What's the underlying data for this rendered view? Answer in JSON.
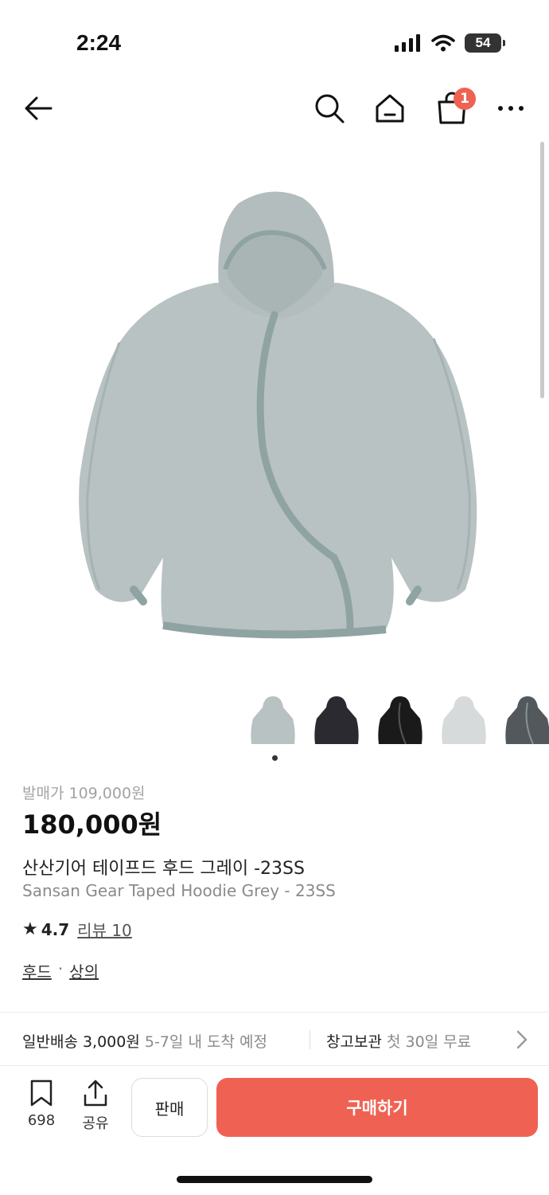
{
  "status_bar": {
    "time": "2:24",
    "battery": "54",
    "icons": [
      "signal-icon",
      "wifi-icon",
      "battery-icon"
    ]
  },
  "nav": {
    "icons": [
      "back-arrow-icon",
      "search-icon",
      "home-icon",
      "shopping-bag-icon",
      "more-icon"
    ],
    "cart_badge": "1"
  },
  "product": {
    "image_alt": "gray hoodie",
    "thumbnails": [
      {
        "name": "grey",
        "color": "#b8c2c2"
      },
      {
        "name": "black-navy",
        "color": "#2a2a30"
      },
      {
        "name": "black-taped",
        "color": "#1a1a1a"
      },
      {
        "name": "light-grey",
        "color": "#d6dadb"
      },
      {
        "name": "charcoal",
        "color": "#52585c"
      }
    ],
    "release_price": "발매가 109,000원",
    "price": "180,000원",
    "name_ko": "산산기어 테이프드 후드 그레이 -23SS",
    "name_en": "Sansan Gear Taped Hoodie Grey - 23SS",
    "rating": "4.7",
    "review_link": "리뷰 10",
    "categories": [
      "후드",
      "상의"
    ],
    "category_sep": "·"
  },
  "shipping": {
    "general_label": "일반배송 3,000원",
    "general_sub": "5-7일 내 도착 예정",
    "storage_label": "창고보관",
    "storage_sub": "첫 30일 무료"
  },
  "actions": {
    "bookmark_count": "698",
    "share_label": "공유",
    "sell_label": "판매",
    "buy_label": "구매하기"
  },
  "colors": {
    "accent": "#ef6253",
    "hoodie": "#b8c2c2",
    "tape": "#8fa3a3"
  }
}
